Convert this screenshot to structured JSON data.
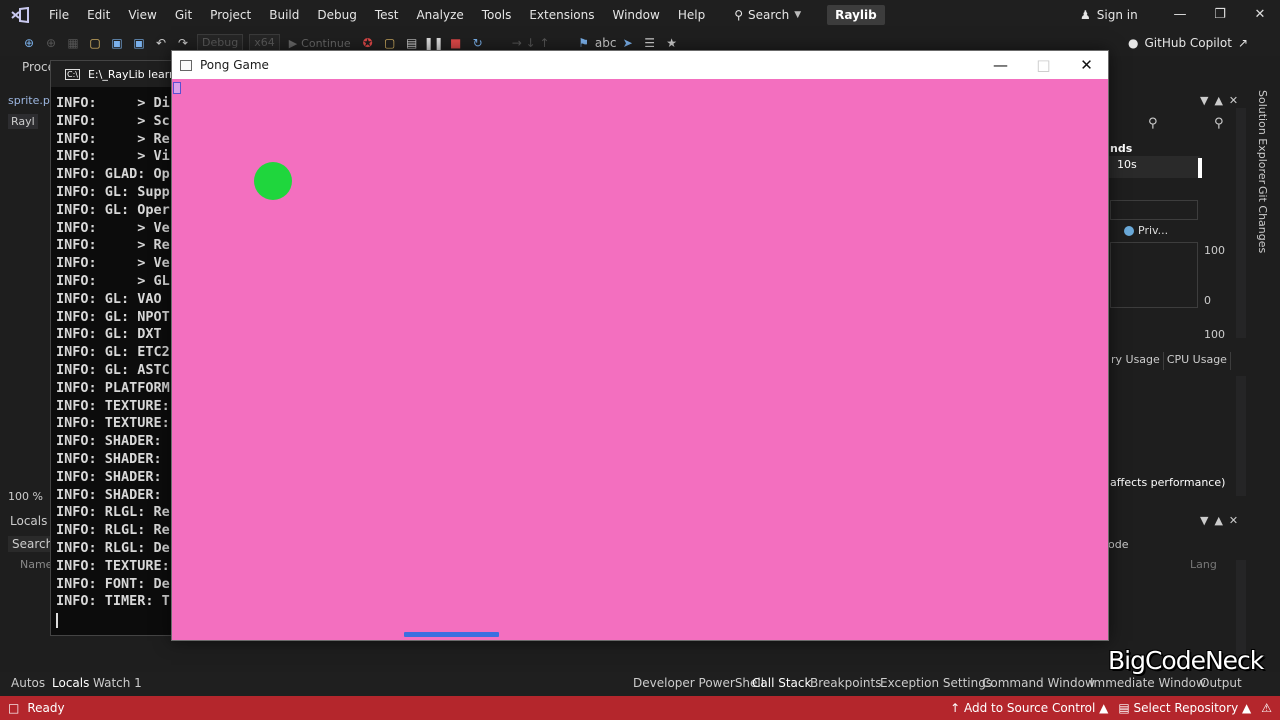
{
  "menubar": {
    "items": [
      "File",
      "Edit",
      "View",
      "Git",
      "Project",
      "Build",
      "Debug",
      "Test",
      "Analyze",
      "Tools",
      "Extensions",
      "Window",
      "Help"
    ],
    "search_label": "Search",
    "solution_name": "Raylib",
    "sign_in": "Sign in"
  },
  "toolbar": {
    "config": "Debug",
    "platform": "x64",
    "continue_label": "Continue",
    "copilot_label": "GitHub Copilot"
  },
  "left": {
    "proc_label": "Proce",
    "sprite_tab": "sprite.p",
    "rayl_tab": "Rayl",
    "zoom": "100 %",
    "locals_header": "Locals",
    "search_label": "Search",
    "name_col": "Name"
  },
  "console": {
    "title": "E:\\_RayLib learn",
    "lines": [
      "INFO:     > Di",
      "INFO:     > Sc",
      "INFO:     > Re",
      "INFO:     > Vi",
      "INFO: GLAD: Op",
      "INFO: GL: Supp",
      "INFO: GL: Oper",
      "INFO:     > Ve",
      "INFO:     > Re",
      "INFO:     > Ve",
      "INFO:     > GL",
      "INFO: GL: VAO",
      "INFO: GL: NPOT",
      "INFO: GL: DXT",
      "INFO: GL: ETC2",
      "INFO: GL: ASTC",
      "INFO: PLATFORM",
      "INFO: TEXTURE:",
      "INFO: TEXTURE:",
      "INFO: SHADER:",
      "INFO: SHADER:",
      "INFO: SHADER:",
      "INFO: SHADER:",
      "INFO: RLGL: Re",
      "INFO: RLGL: Re",
      "INFO: RLGL: De",
      "INFO: TEXTURE:",
      "INFO: FONT: De",
      "INFO: TIMER: T"
    ]
  },
  "pong": {
    "title": "Pong Game",
    "background_color": "#f36fbf",
    "ball_color": "#1fd63d",
    "paddle_color": "#3b6fe0"
  },
  "right": {
    "seconds_label": "nds",
    "interval": "10s",
    "priv_label": "Priv...",
    "axis_max_1": "100",
    "axis_min": "0",
    "axis_max_2": "100",
    "usage_tab_1": "ry Usage",
    "usage_tab_2": "CPU Usage",
    "affects_text": "affects performance)",
    "node_label": "ode",
    "lang_label": "Lang",
    "vert_tab_1": "Solution Explorer",
    "vert_tab_2": "Git Changes"
  },
  "bottom_tabs": {
    "autos": "Autos",
    "locals": "Locals",
    "watch": "Watch 1",
    "dev_ps": "Developer PowerShell",
    "call_stack": "Call Stack",
    "breakpoints": "Breakpoints",
    "exceptions": "Exception Settings",
    "command": "Command Window",
    "immediate": "Immediate Window",
    "output": "Output"
  },
  "statusbar": {
    "ready": "Ready",
    "add_source": "Add to Source Control",
    "select_repo": "Select Repository",
    "status_color": "#b4262c"
  },
  "watermark": "BigCodeNeck"
}
